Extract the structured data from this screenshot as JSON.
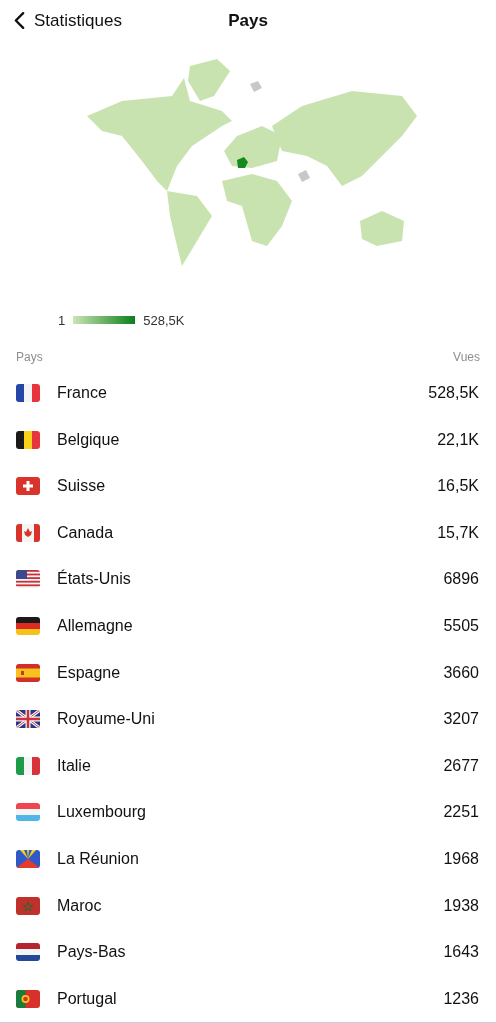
{
  "nav": {
    "back": "Statistiques",
    "title": "Pays"
  },
  "legend": {
    "min": "1",
    "max": "528,5K"
  },
  "columns": {
    "name": "Pays",
    "value": "Vues"
  },
  "rows": [
    {
      "kind": "fr",
      "name": "France",
      "value": "528,5K"
    },
    {
      "kind": "be",
      "name": "Belgique",
      "value": "22,1K"
    },
    {
      "kind": "ch",
      "name": "Suisse",
      "value": "16,5K"
    },
    {
      "kind": "ca",
      "name": "Canada",
      "value": "15,7K"
    },
    {
      "kind": "us",
      "name": "États-Unis",
      "value": "6896"
    },
    {
      "kind": "de",
      "name": "Allemagne",
      "value": "5505"
    },
    {
      "kind": "es",
      "name": "Espagne",
      "value": "3660"
    },
    {
      "kind": "gb",
      "name": "Royaume-Uni",
      "value": "3207"
    },
    {
      "kind": "it",
      "name": "Italie",
      "value": "2677"
    },
    {
      "kind": "lu",
      "name": "Luxembourg",
      "value": "2251"
    },
    {
      "kind": "re",
      "name": "La Réunion",
      "value": "1968"
    },
    {
      "kind": "ma",
      "name": "Maroc",
      "value": "1938"
    },
    {
      "kind": "nl",
      "name": "Pays-Bas",
      "value": "1643"
    },
    {
      "kind": "pt",
      "name": "Portugal",
      "value": "1236"
    }
  ]
}
